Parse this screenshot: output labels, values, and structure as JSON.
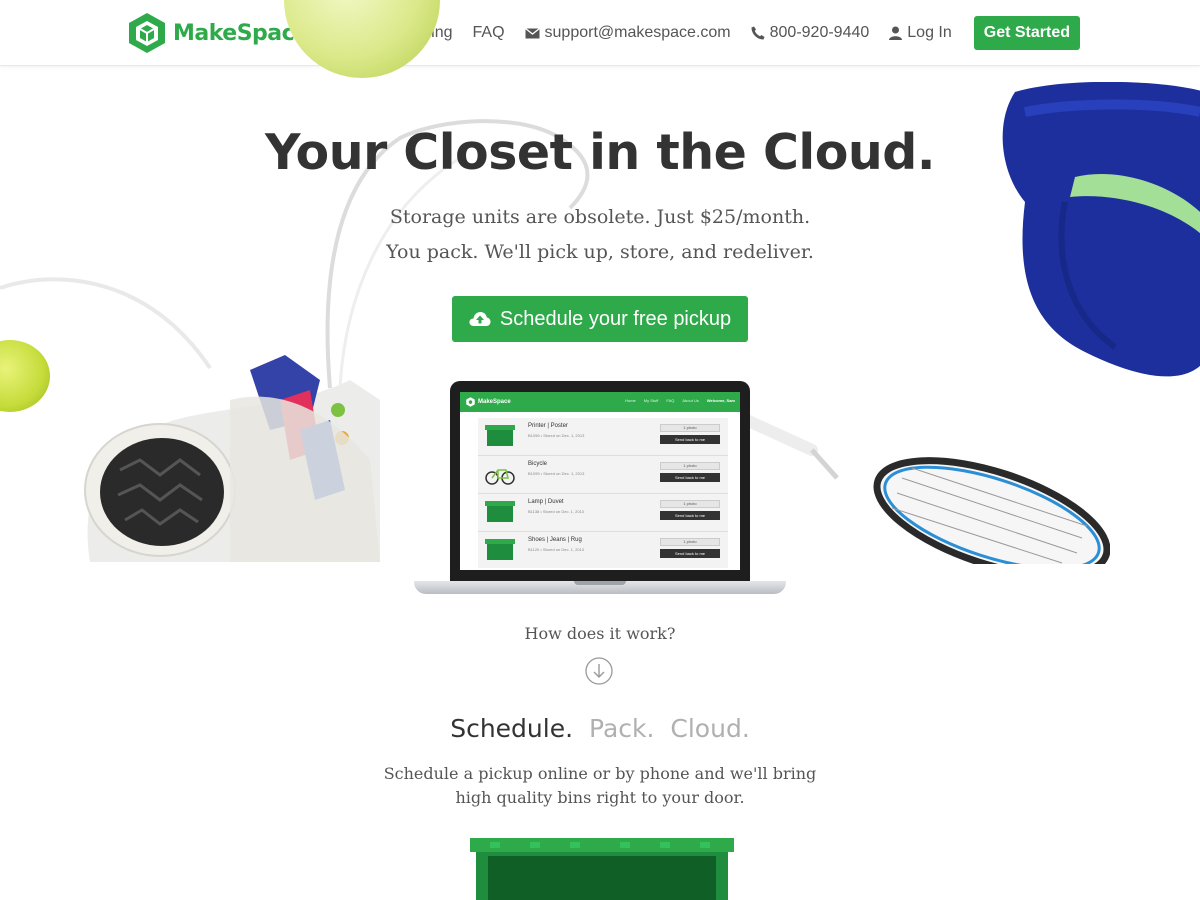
{
  "brand": {
    "name": "MakeSpace",
    "color": "#2eaa4a"
  },
  "nav": {
    "pricing": "Pricing",
    "faq": "FAQ",
    "email": "support@makespace.com",
    "phone": "800-920-9440",
    "login": "Log In",
    "get_started": "Get Started"
  },
  "hero": {
    "title": "Your Closet in the Cloud.",
    "subtitle_line1": "Storage units are obsolete. Just $25/month.",
    "subtitle_line2": "You pack. We'll pick up, store, and redeliver.",
    "cta": "Schedule your free pickup"
  },
  "laptop_screen": {
    "brand": "MakeSpace",
    "links": [
      "Home",
      "My Stuff",
      "FAQ",
      "About Us",
      "Welcome, Sam"
    ],
    "items": [
      {
        "title": "Printer | Poster",
        "meta": "B1096 • Stored on Dec. 1, 2013",
        "photo_btn": "1 photo",
        "send_btn": "Send back to me"
      },
      {
        "title": "Bicycle",
        "meta": "B1095 • Stored on Dec. 1, 2013",
        "photo_btn": "1 photo",
        "send_btn": "Send back to me"
      },
      {
        "title": "Lamp | Duvet",
        "meta": "B1138 • Stored on Dec. 1, 2013",
        "photo_btn": "1 photo",
        "send_btn": "Send back to me"
      },
      {
        "title": "Shoes | Jeans | Rug",
        "meta": "B1120 • Stored on Dec. 1, 2013",
        "photo_btn": "1 photo",
        "send_btn": "Send back to me"
      }
    ]
  },
  "how": {
    "question": "How does it work?",
    "steps": [
      "Schedule.",
      "Pack.",
      "Cloud."
    ],
    "description": "Schedule a pickup online or by phone and we'll bring high quality bins right to your door."
  },
  "icons": [
    "logo-cube-icon",
    "envelope-icon",
    "phone-icon",
    "user-icon",
    "cloud-upload-icon",
    "arrow-down-circle-icon"
  ]
}
